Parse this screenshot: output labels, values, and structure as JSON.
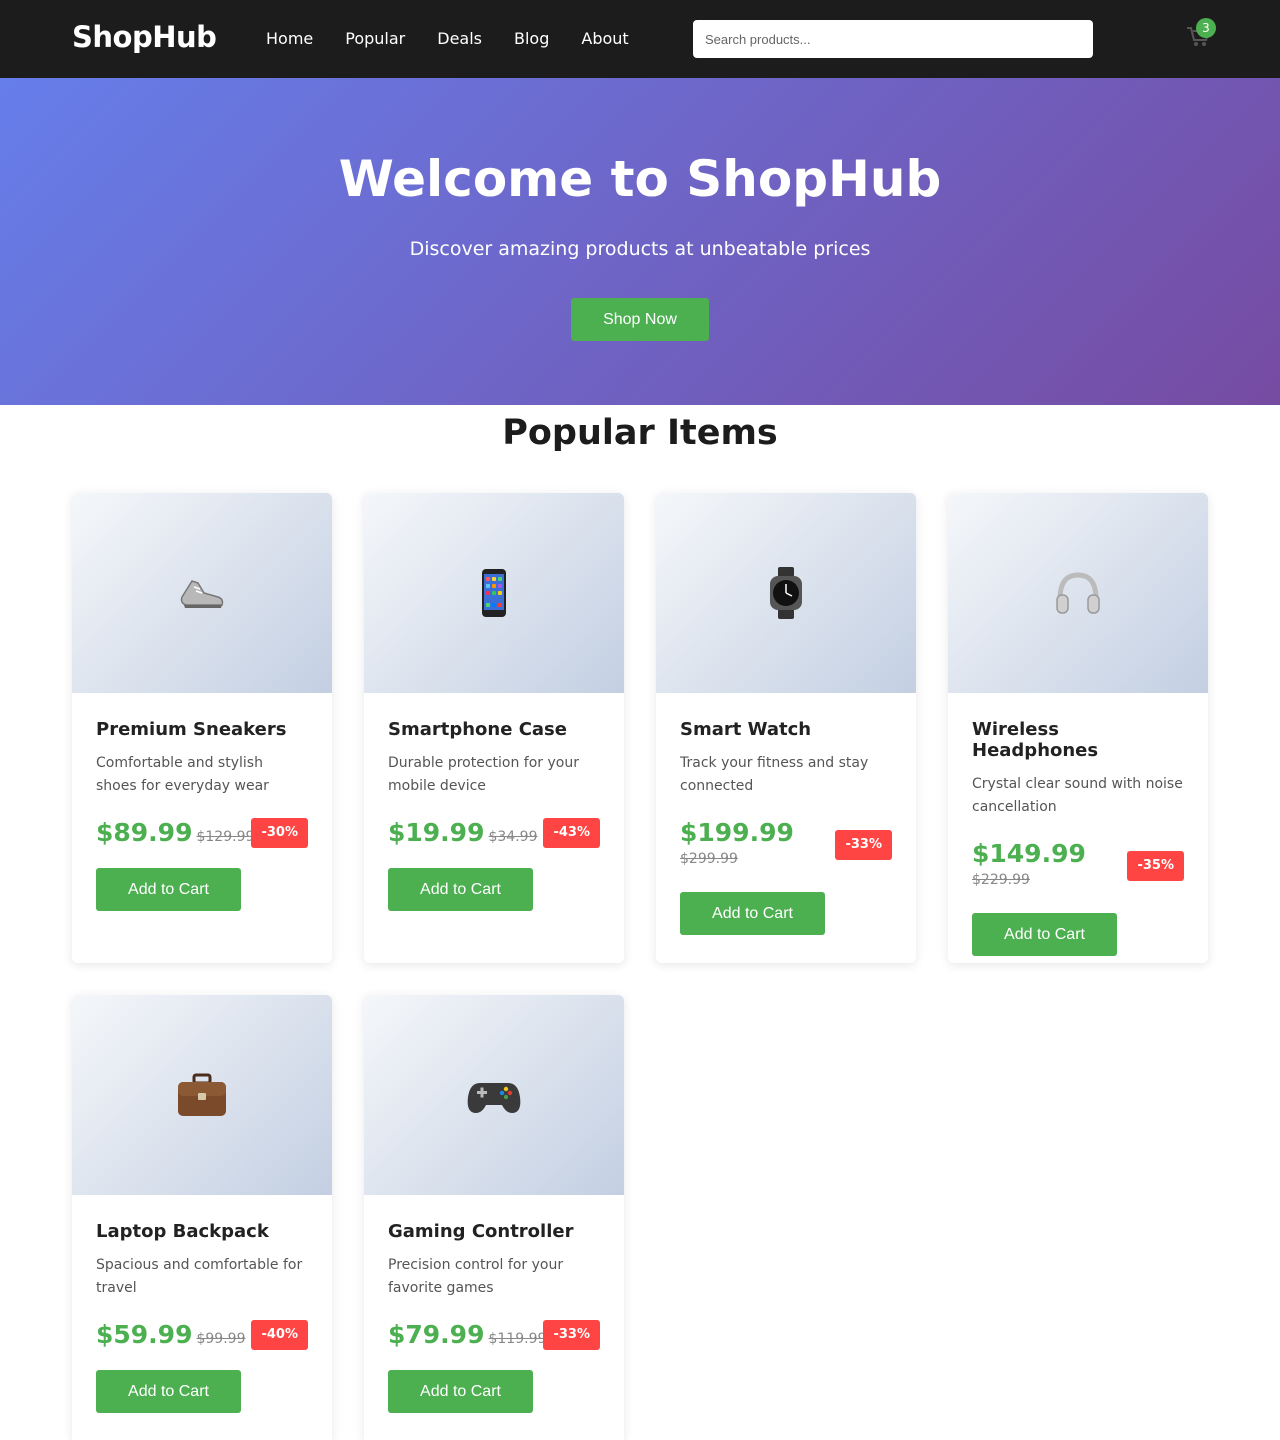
{
  "header": {
    "logo": "ShopHub",
    "nav": [
      "Home",
      "Popular",
      "Deals",
      "Blog",
      "About"
    ],
    "search_placeholder": "Search products...",
    "cart_count": "3"
  },
  "hero": {
    "title": "Welcome to ShopHub",
    "subtitle": "Discover amazing products at unbeatable prices",
    "button": "Shop Now"
  },
  "section": {
    "title": "Popular Items"
  },
  "products": [
    {
      "icon": "sneaker-icon",
      "name": "Premium Sneakers",
      "desc": "Comfortable and stylish shoes for everyday wear",
      "price": "$89.99",
      "old_price": "$129.99",
      "discount": "-30%",
      "button": "Add to Cart"
    },
    {
      "icon": "smartphone-icon",
      "name": "Smartphone Case",
      "desc": "Durable protection for your mobile device",
      "price": "$19.99",
      "old_price": "$34.99",
      "discount": "-43%",
      "button": "Add to Cart"
    },
    {
      "icon": "watch-icon",
      "name": "Smart Watch",
      "desc": "Track your fitness and stay connected",
      "price": "$199.99",
      "old_price": "$299.99",
      "discount": "-33%",
      "button": "Add to Cart"
    },
    {
      "icon": "headphones-icon",
      "name": "Wireless Headphones",
      "desc": "Crystal clear sound with noise cancellation",
      "price": "$149.99",
      "old_price": "$229.99",
      "discount": "-35%",
      "button": "Add to Cart"
    },
    {
      "icon": "briefcase-icon",
      "name": "Laptop Backpack",
      "desc": "Spacious and comfortable for travel",
      "price": "$59.99",
      "old_price": "$99.99",
      "discount": "-40%",
      "button": "Add to Cart"
    },
    {
      "icon": "gamepad-icon",
      "name": "Gaming Controller",
      "desc": "Precision control for your favorite games",
      "price": "$79.99",
      "old_price": "$119.99",
      "discount": "-33%",
      "button": "Add to Cart"
    }
  ],
  "colors": {
    "accent": "#4caf50",
    "discount": "#ff4444",
    "header": "#1c1c1c",
    "hero_start": "#667eea",
    "hero_end": "#764ba2"
  }
}
